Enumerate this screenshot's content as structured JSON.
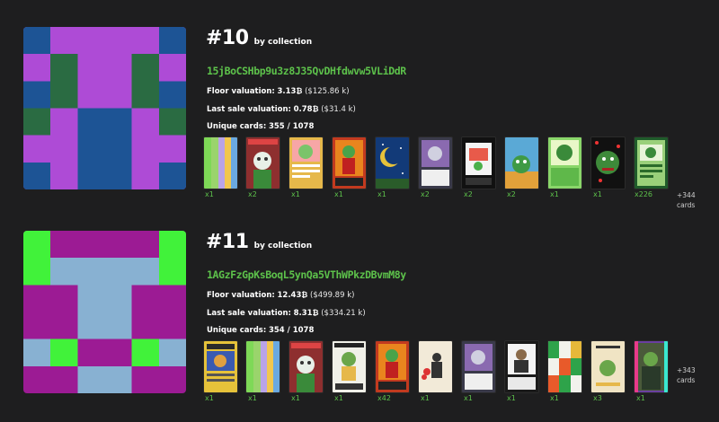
{
  "collections": [
    {
      "rank": "#10",
      "by_label": "by collection",
      "address": "15jBoCSHbp9u3z8J35QvDHfdwvw5VLiDdR",
      "floor": {
        "label": "Floor valuation:",
        "value": "3.13₿",
        "usd": "($125.86 k)"
      },
      "last_sale": {
        "label": "Last sale valuation:",
        "value": "0.78₿",
        "usd": "($31.4 k)"
      },
      "unique": {
        "label": "Unique cards:",
        "value": "355 / 1078"
      },
      "card_counts": [
        "x1",
        "x2",
        "x1",
        "x1",
        "x1",
        "x2",
        "x2",
        "x2",
        "x1",
        "x1",
        "x226"
      ],
      "more_cards": {
        "count": "+344",
        "label": "cards"
      },
      "colors": {
        "primary": "#ae4bd6",
        "secondary": "#1d5495",
        "tertiary": "#2a6b42"
      }
    },
    {
      "rank": "#11",
      "by_label": "by collection",
      "address": "1AGzFzGpKsBoqL5ynQa5VThWPkzDBvmM8y",
      "floor": {
        "label": "Floor valuation:",
        "value": "12.43₿",
        "usd": "($499.89 k)"
      },
      "last_sale": {
        "label": "Last sale valuation:",
        "value": "8.31₿",
        "usd": "($334.21 k)"
      },
      "unique": {
        "label": "Unique cards:",
        "value": "354 / 1078"
      },
      "card_counts": [
        "x1",
        "x1",
        "x1",
        "x1",
        "x42",
        "x1",
        "x1",
        "x1",
        "x1",
        "x3",
        "x1"
      ],
      "more_cards": {
        "count": "+343",
        "label": "cards"
      },
      "colors": {
        "primary": "#9c1b94",
        "secondary": "#88b1d2",
        "tertiary": "#41f23a"
      }
    }
  ]
}
